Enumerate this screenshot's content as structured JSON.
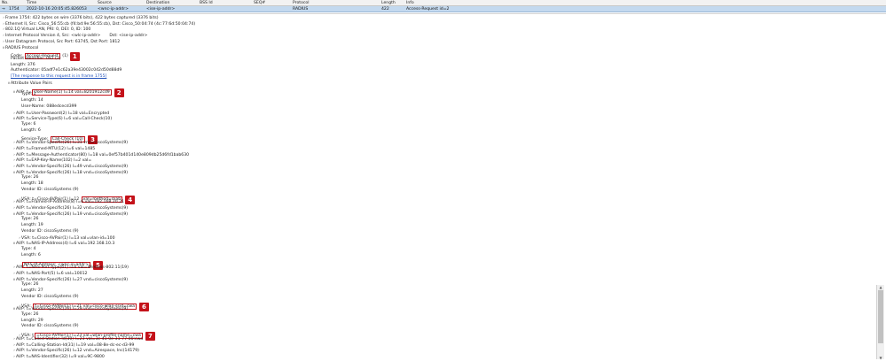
{
  "columns": [
    "No.",
    "Time",
    "Source",
    "Destination",
    "BSS Id",
    "SEQ#",
    "Protocol",
    "Length",
    "Info"
  ],
  "packet": {
    "no": "1754",
    "time": "2022-10-16 20:05:45.826053",
    "source": "<wnc-ip-addr>",
    "destination": "<ise-ip-addr>",
    "protocol": "RADIUS",
    "length": "422",
    "info": "Access-Request id=2"
  },
  "tree": [
    {
      "t": "Frame 1754: 422 bytes on wire (3376 bits), 422 bytes captured (3376 bits)",
      "a": ">"
    },
    {
      "t": "Ethernet II, Src: Cisco_56:55:cb (f4:bd:9e:56:55:cb), Dst: Cisco_50:04:74 (4c:77:6d:50:04:74)",
      "a": ">"
    },
    {
      "t": "802.1Q Virtual LAN, PRI: 0, DEI: 0, ID: 100",
      "a": ">"
    },
    {
      "t": "Internet Protocol Version 4, Src: <wlc-ip-addr>",
      "t2": "Dst: <ise-ip-addr>",
      "a": ">"
    },
    {
      "t": "User Datagram Protocol, Src Port: 63745, Dst Port: 1812",
      "a": ">"
    },
    {
      "t": "RADIUS Protocol",
      "a": "v"
    },
    {
      "t": "Code: ",
      "h": "Access-Request",
      "t2": " (1)",
      "i": 1,
      "b": "1"
    },
    {
      "t": "Packet identifier: 0x2 (2)",
      "i": 1
    },
    {
      "t": "Length: 376",
      "i": 1
    },
    {
      "t": "Authenticator: 05adf7e1c62a39e43002c042d50d88d9",
      "i": 1
    },
    {
      "t": "[The response to this request is in frame 1755]",
      "i": 1,
      "link": true
    },
    {
      "t": "Attribute Value Pairs",
      "i": 1,
      "a": "v"
    },
    {
      "t": "AVP: t=",
      "h": "User-Name(1) l=14 val=8201912cd9",
      "i": 2,
      "a": "v",
      "b": "2"
    },
    {
      "t": "Type: 1",
      "i": 3
    },
    {
      "t": "Length: 14",
      "i": 3
    },
    {
      "t": "User-Name: 088edcecd399",
      "i": 3
    },
    {
      "t": "AVP: t=User-Password(2) l=18 val=Encrypted",
      "i": 2,
      "a": ">"
    },
    {
      "t": "AVP: t=Service-Type(6) l=6 val=Call-Check(10)",
      "i": 2,
      "a": "v"
    },
    {
      "t": "Type: 6",
      "i": 3
    },
    {
      "t": "Length: 6",
      "i": 3
    },
    {
      "t": "Service-Type: ",
      "h": "Call-Check (10)",
      "i": 3,
      "b": "3"
    },
    {
      "t": "AVP: t=Vendor-Specific(26) l=31 vnd=ciscoSystems(9)",
      "i": 2,
      "a": ">"
    },
    {
      "t": "AVP: t=Framed-MTU(12) l=6 val=1485",
      "i": 2,
      "a": ">"
    },
    {
      "t": "AVP: t=Message-Authenticator(80) l=18 val=0ef57b401d140e809db25d6fd1bab630",
      "i": 2,
      "a": ">"
    },
    {
      "t": "AVP: t=EAP-Key-Name(102) l=2 val=",
      "i": 2,
      "a": ">"
    },
    {
      "t": "AVP: t=Vendor-Specific(26) l=49 vnd=ciscoSystems(9)",
      "i": 2,
      "a": ">"
    },
    {
      "t": "AVP: t=Vendor-Specific(26) l=18 vnd=ciscoSystems(9)",
      "i": 2,
      "a": "v"
    },
    {
      "t": "Type: 26",
      "i": 3
    },
    {
      "t": "Length: 18",
      "i": 3
    },
    {
      "t": "Vendor ID: ciscoSystems (9)",
      "i": 3
    },
    {
      "t": "VSA: t=Cisco-AVPair(1) l=12 ",
      "h": "val=method=mab",
      "i": 3,
      "a": ">",
      "b": "4"
    },
    {
      "t": "AVP: t=Framed-IP-Address(8) l=6 val=192.168.20.21",
      "i": 2,
      "a": ">"
    },
    {
      "t": "AVP: t=Vendor-Specific(26) l=32 vnd=ciscoSystems(9)",
      "i": 2,
      "a": ">"
    },
    {
      "t": "AVP: t=Vendor-Specific(26) l=19 vnd=ciscoSystems(9)",
      "i": 2,
      "a": "v"
    },
    {
      "t": "Type: 26",
      "i": 3
    },
    {
      "t": "Length: 19",
      "i": 3
    },
    {
      "t": "Vendor ID: ciscoSystems (9)",
      "i": 3
    },
    {
      "t": "VSA: t=Cisco-AVPair(1) l=13 val=vlan-id=100",
      "i": 3,
      "a": ">"
    },
    {
      "t": "AVP: t=NAS-IP-Address(4) l=6 val=192.168.10.3",
      "i": 2,
      "a": "v"
    },
    {
      "t": "Type: 4",
      "i": 3
    },
    {
      "t": "Length: 6",
      "i": 3
    },
    {
      "h": "NAS-IP-Address: <wnc-ip-addr>",
      "i": 3,
      "b": "5"
    },
    {
      "t": "AVP: t=NAS-Port-Type(61) l=6 val=Wireless-802.11(19)",
      "i": 2,
      "a": ">"
    },
    {
      "t": "AVP: t=NAS-Port(5) l=6 val=10012",
      "i": 2,
      "a": ">"
    },
    {
      "t": "AVP: t=Vendor-Specific(26) l=27 vnd=ciscoSystems(9)",
      "i": 2,
      "a": "v"
    },
    {
      "t": "Type: 26",
      "i": 3
    },
    {
      "t": "Length: 27",
      "i": 3
    },
    {
      "t": "Vendor ID: ciscoSystems (9)",
      "i": 3
    },
    {
      "t": "VSA: ",
      "h": "t=Cisco-AVPair(1) l=21 val=cisco-wlan-ssid=cwa",
      "i": 3,
      "a": ">",
      "b": "6"
    },
    {
      "t": "AVP: t=Vendor-Specific(26) l=29 vnd=ciscoSystems(9)",
      "i": 2,
      "a": "v"
    },
    {
      "t": "Type: 26",
      "i": 3
    },
    {
      "t": "Length: 29",
      "i": 3
    },
    {
      "t": "Vendor ID: ciscoSystems (9)",
      "i": 3
    },
    {
      "t": "VSA: t",
      "h": "=Cisco-AVPair(1) l=23 val=wlan-profile-name=cwa",
      "i": 3,
      "a": ">",
      "b": "7"
    },
    {
      "t": "AVP: t=Called-Station-Id(30) l=23 val=3c-41-0e-31-77-00:cwa",
      "i": 2,
      "a": ">"
    },
    {
      "t": "AVP: t=Calling-Station-Id(31) l=19 val=08-8e-dc-ec-d3-99",
      "i": 2,
      "a": ">"
    },
    {
      "t": "AVP: t=Vendor-Specific(26) l=12 vnd=Airespace, Inc(14179)",
      "i": 2,
      "a": ">"
    },
    {
      "t": "AVP: t=NAS-Identifier(32) l=9 val=9C-9800",
      "i": 2,
      "a": ">"
    }
  ]
}
